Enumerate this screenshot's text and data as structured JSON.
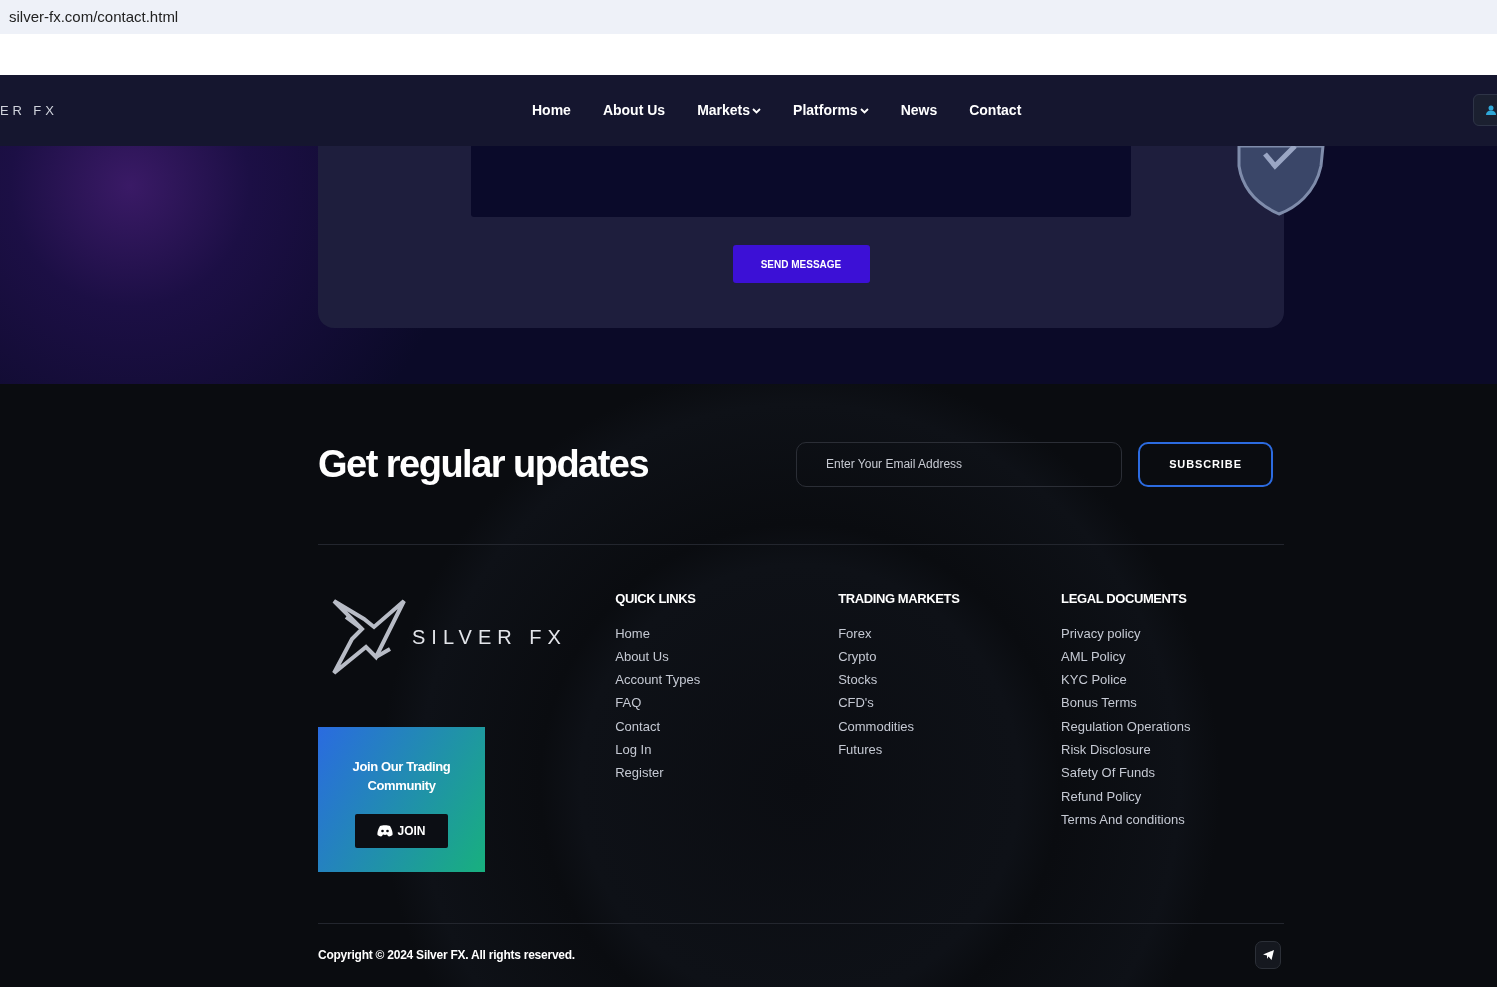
{
  "browser": {
    "url": "silver-fx.com/contact.html"
  },
  "nav": {
    "logo_text": "ER FX",
    "items": [
      {
        "label": "Home",
        "dropdown": false
      },
      {
        "label": "About Us",
        "dropdown": false
      },
      {
        "label": "Markets",
        "dropdown": true
      },
      {
        "label": "Platforms",
        "dropdown": true
      },
      {
        "label": "News",
        "dropdown": false
      },
      {
        "label": "Contact",
        "dropdown": false
      }
    ]
  },
  "contact_form": {
    "button": "SEND MESSAGE"
  },
  "newsletter": {
    "title": "Get regular updates",
    "placeholder": "Enter Your Email Address",
    "button": "SUBSCRIBE"
  },
  "footer": {
    "logo_text": "SILVER FX",
    "community": {
      "title": "Join Our Trading Community",
      "button": "JOIN"
    },
    "columns": [
      {
        "heading": "QUICK LINKS",
        "links": [
          "Home",
          "About Us",
          "Account Types",
          "FAQ",
          "Contact",
          "Log In",
          "Register"
        ]
      },
      {
        "heading": "TRADING MARKETS",
        "links": [
          "Forex",
          "Crypto",
          "Stocks",
          "CFD's",
          "Commodities",
          "Futures"
        ]
      },
      {
        "heading": "LEGAL DOCUMENTS",
        "links": [
          "Privacy policy",
          "AML Policy",
          "KYC Police",
          "Bonus Terms",
          "Regulation Operations",
          "Risk Disclosure",
          "Safety Of Funds",
          "Refund Policy",
          "Terms And conditions"
        ]
      }
    ],
    "copyright": "Copyright © 2024 Silver FX. All rights reserved."
  }
}
